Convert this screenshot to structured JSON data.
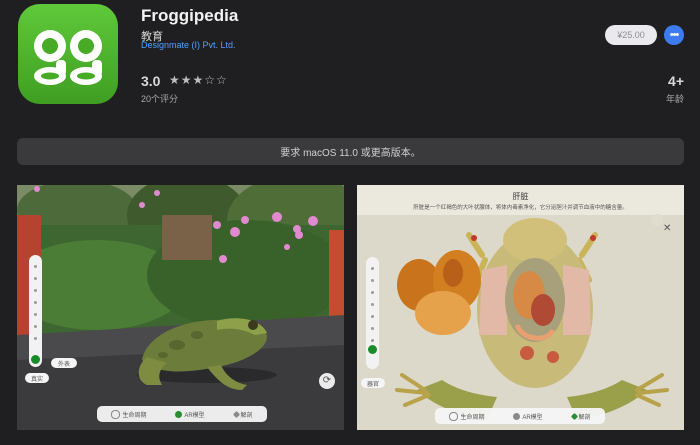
{
  "app": {
    "icon_text": "gg",
    "name": "Froggipedia",
    "category": "教育",
    "developer": "Designmate (I) Pvt. Ltd."
  },
  "actions": {
    "price": "¥25.00",
    "more": "•••"
  },
  "rating": {
    "value": "3.0",
    "stars": "★★★☆☆",
    "count": "20个评分"
  },
  "age": {
    "value": "4+",
    "label": "年龄"
  },
  "requirement": "要求 macOS 11.0 或更高版本。",
  "screenshot1": {
    "pill_top": "外表",
    "pill_bottom": "真实",
    "bar_items": [
      "生命周期",
      "AR模型",
      "解剖"
    ]
  },
  "screenshot2": {
    "organ_title": "肝脏",
    "organ_desc": "肝脏是一个红褐色的大叶状腺体，将体内毒素净化，它分泌胆汁并调节血液中的糖含量。",
    "pill_bottom": "器官",
    "bar_items": [
      "生命周期",
      "AR模型",
      "解剖"
    ]
  },
  "colors": {
    "background": "#1f1f21",
    "accent": "#3d7bf0",
    "icon_green": "#4db52a",
    "link": "#4ea2ff"
  }
}
